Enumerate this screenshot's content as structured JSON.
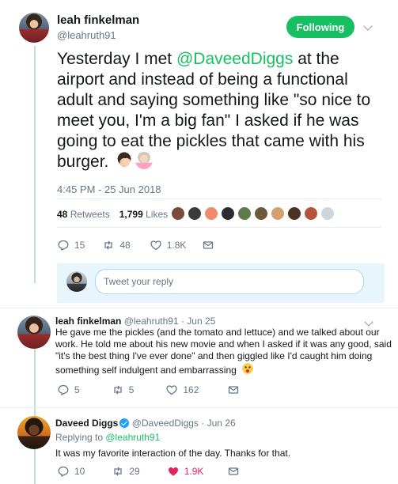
{
  "main_tweet": {
    "name": "leah finkelman",
    "handle": "@leahruth91",
    "follow_label": "Following",
    "text_before": "Yesterday I met ",
    "mention": "@DaveedDiggs",
    "text_after": " at the airport and instead of being a functional adult and saying something like \"so nice to meet you, I'm a big fan\" I asked if he was going to eat the pickles that came with his burger.",
    "timestamp": "4:45 PM - 25 Jun 2018",
    "retweets_count": "48",
    "retweets_label": "Retweets",
    "likes_count": "1,799",
    "likes_label": "Likes",
    "liker_face_colors": [
      "#7a4a3a",
      "#3b3b3b",
      "#f08a6c",
      "#2c2c2c",
      "#5d7a4c",
      "#6b5a3a",
      "#d3a16b",
      "#4a3226",
      "#b5533c",
      "#ccd6dd"
    ],
    "actions": {
      "replies": "15",
      "retweets": "48",
      "likes": "1.8K"
    }
  },
  "reply_box": {
    "placeholder": "Tweet your reply"
  },
  "replies": [
    {
      "name": "leah finkelman",
      "handle_date": "@leahruth91 · Jun 25",
      "lines": [
        "He gave me the pickles (and the tomato and lettuce) and we talked about our",
        "work. He told me about his new movie and when I asked if it was any good, said",
        "\"it's the best thing I've ever done\" and then giggled like I'd caught him doing",
        "something self indulgent and embarrassing"
      ],
      "actions": {
        "replies": "5",
        "retweets": "5",
        "likes": "162"
      }
    },
    {
      "name": "Daveed Diggs",
      "handle_date": "@DaveedDiggs · Jun 26",
      "replying_prefix": "Replying to ",
      "replying_to": "@leahruth91",
      "lines": [
        "It was my favorite interaction of the day. Thanks for that."
      ],
      "actions": {
        "replies": "10",
        "retweets": "29",
        "likes": "1.9K"
      }
    }
  ],
  "colors": {
    "accent": "#17bf63",
    "muted": "#657786",
    "like": "#e0245e",
    "thread_line": "#b6e6cf"
  }
}
